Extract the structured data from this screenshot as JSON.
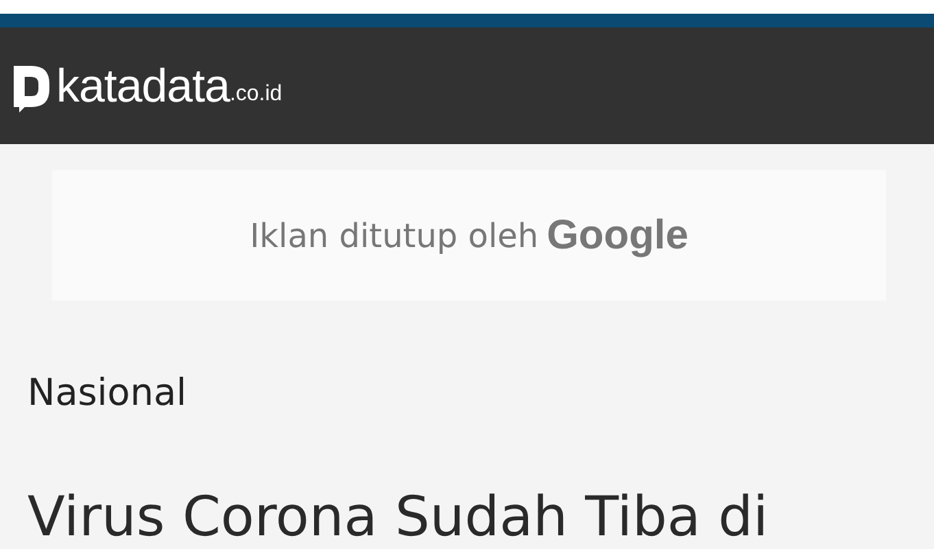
{
  "header": {
    "logo_text": "katadata",
    "logo_suffix": ".co.id"
  },
  "ad": {
    "notice": "Iklan ditutup oleh",
    "brand": "Google"
  },
  "article": {
    "category": "Nasional",
    "headline": "Virus Corona Sudah Tiba di"
  }
}
